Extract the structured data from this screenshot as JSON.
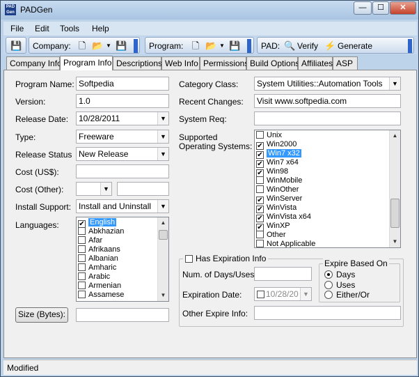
{
  "window": {
    "title": "PADGen",
    "icon_text": "PAD Gen",
    "min": "—",
    "max": "☐",
    "close": "✕"
  },
  "menu": [
    "File",
    "Edit",
    "Tools",
    "Help"
  ],
  "toolbar": {
    "company_label": "Company:",
    "program_label": "Program:",
    "pad_label": "PAD:",
    "verify_label": "Verify",
    "generate_label": "Generate"
  },
  "tabs": [
    "Company Info",
    "Program Info",
    "Descriptions",
    "Web Info",
    "Permissions",
    "Build Options",
    "Affiliates",
    "ASP"
  ],
  "form": {
    "program_name_label": "Program Name:",
    "program_name": "Softpedia",
    "version_label": "Version:",
    "version": "1.0",
    "release_date_label": "Release Date:",
    "release_date": "10/28/2011",
    "type_label": "Type:",
    "type": "Freeware",
    "release_status_label": "Release Status",
    "release_status": "New Release",
    "cost_us_label": "Cost (US$):",
    "cost_us": "",
    "cost_other_label": "Cost (Other):",
    "cost_other_currency": "",
    "cost_other": "",
    "install_support_label": "Install Support:",
    "install_support": "Install and Uninstall",
    "languages_label": "Languages:",
    "size_button": "Size (Bytes):",
    "size": "",
    "category_label": "Category Class:",
    "category": "System Utilities::Automation Tools",
    "recent_changes_label": "Recent Changes:",
    "recent_changes": "Visit www.softpedia.com",
    "system_req_label": "System Req:",
    "system_req": "",
    "supported_os_label_1": "Supported",
    "supported_os_label_2": "Operating Systems:",
    "has_expiration_label": "Has Expiration Info",
    "num_days_label": "Num. of Days/Uses:",
    "num_days": "",
    "expiration_date_label": "Expiration Date:",
    "expiration_date": "10/28/20",
    "other_expire_label": "Other Expire Info:",
    "other_expire": "",
    "expire_based_label": "Expire Based On",
    "expire_options": [
      "Days",
      "Uses",
      "Either/Or"
    ]
  },
  "languages": [
    {
      "label": "English",
      "checked": true,
      "selected": true
    },
    {
      "label": "Abkhazian",
      "checked": false
    },
    {
      "label": "Afar",
      "checked": false
    },
    {
      "label": "Afrikaans",
      "checked": false
    },
    {
      "label": "Albanian",
      "checked": false
    },
    {
      "label": "Amharic",
      "checked": false
    },
    {
      "label": "Arabic",
      "checked": false
    },
    {
      "label": "Armenian",
      "checked": false
    },
    {
      "label": "Assamese",
      "checked": false
    }
  ],
  "operating_systems": [
    {
      "label": "Unix",
      "checked": false
    },
    {
      "label": "Win2000",
      "checked": true
    },
    {
      "label": "Win7 x32",
      "checked": true,
      "selected": true
    },
    {
      "label": "Win7 x64",
      "checked": true
    },
    {
      "label": "Win98",
      "checked": true
    },
    {
      "label": "WinMobile",
      "checked": false
    },
    {
      "label": "WinOther",
      "checked": false
    },
    {
      "label": "WinServer",
      "checked": true
    },
    {
      "label": "WinVista",
      "checked": true
    },
    {
      "label": "WinVista x64",
      "checked": true
    },
    {
      "label": "WinXP",
      "checked": true
    },
    {
      "label": "Other",
      "checked": false
    },
    {
      "label": "Not Applicable",
      "checked": false
    }
  ],
  "status": {
    "text": "Modified"
  },
  "icons": {
    "check": "✔",
    "dropdown": "▼",
    "up": "▲",
    "down": "▼"
  }
}
